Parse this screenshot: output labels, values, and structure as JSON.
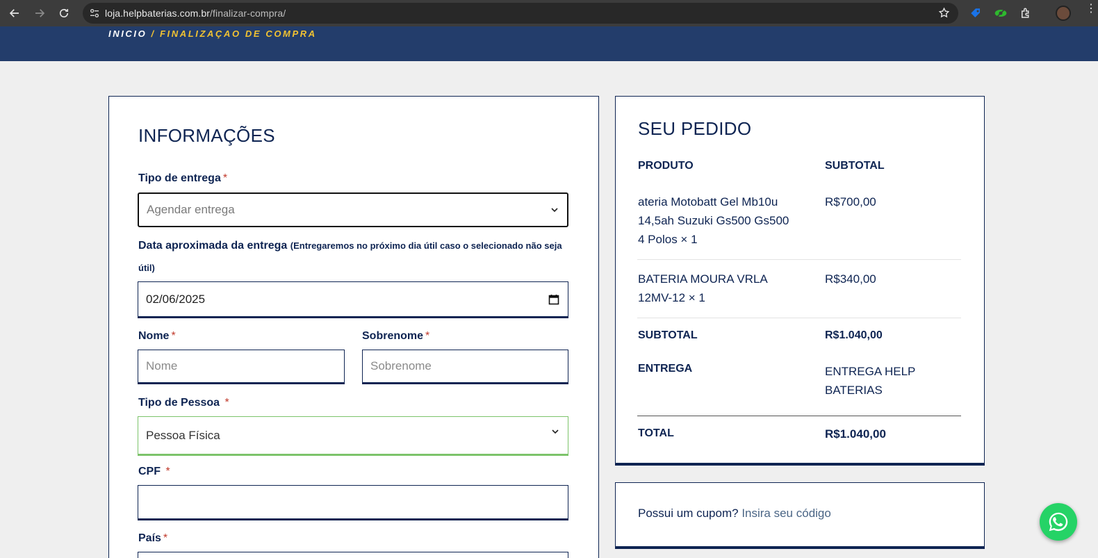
{
  "browser": {
    "url_host": "loja.helpbaterias.com.br",
    "url_path": "/finalizar-compra/"
  },
  "breadcrumb": {
    "home": "INICIO",
    "separator": " / ",
    "current": "FINALIZAÇAO DE COMPRA"
  },
  "form": {
    "title": "INFORMAÇÕES",
    "delivery_type": {
      "label": "Tipo de entrega",
      "required": "*",
      "value": "Agendar entrega"
    },
    "delivery_date": {
      "label": "Data aproximada da entrega",
      "hint_line1": "(Entregaremos no próximo dia útil caso o selecionado não seja",
      "hint_line2": "útil)",
      "value": "02/06/2025"
    },
    "first_name": {
      "label": "Nome",
      "required": "*",
      "placeholder": "Nome"
    },
    "last_name": {
      "label": "Sobrenome",
      "required": "*",
      "placeholder": "Sobrenome"
    },
    "person_type": {
      "label": "Tipo de Pessoa",
      "required": "*",
      "value": "Pessoa Física"
    },
    "cpf": {
      "label": "CPF",
      "required": "*",
      "value": ""
    },
    "country": {
      "label": "País",
      "required": "*"
    }
  },
  "order": {
    "title": "SEU PEDIDO",
    "col_product": "PRODUTO",
    "col_subtotal": "SUBTOTAL",
    "items": [
      {
        "name_line1": "ateria Motobatt Gel Mb10u",
        "name_line2": "14,5ah Suzuki Gs500 Gs500",
        "name_line3": "4 Polos  × 1",
        "price": "R$700,00"
      },
      {
        "name_line1": "BATERIA MOURA VRLA",
        "name_line2": "12MV-12  × 1",
        "price": "R$340,00"
      }
    ],
    "subtotal_label": "SUBTOTAL",
    "subtotal_value": "R$1.040,00",
    "shipping_label": "ENTREGA",
    "shipping_line1": "ENTREGA HELP",
    "shipping_line2": "BATERIAS",
    "total_label": "TOTAL",
    "total_value": "R$1.040,00"
  },
  "coupon": {
    "question": "Possui um cupom?",
    "link": "Insira seu código"
  },
  "colors": {
    "navy": "#0e2452",
    "header_blue": "#233d6b",
    "accent_yellow": "#f1c232",
    "whatsapp_green": "#25d366",
    "valid_green": "#7cc36a"
  }
}
